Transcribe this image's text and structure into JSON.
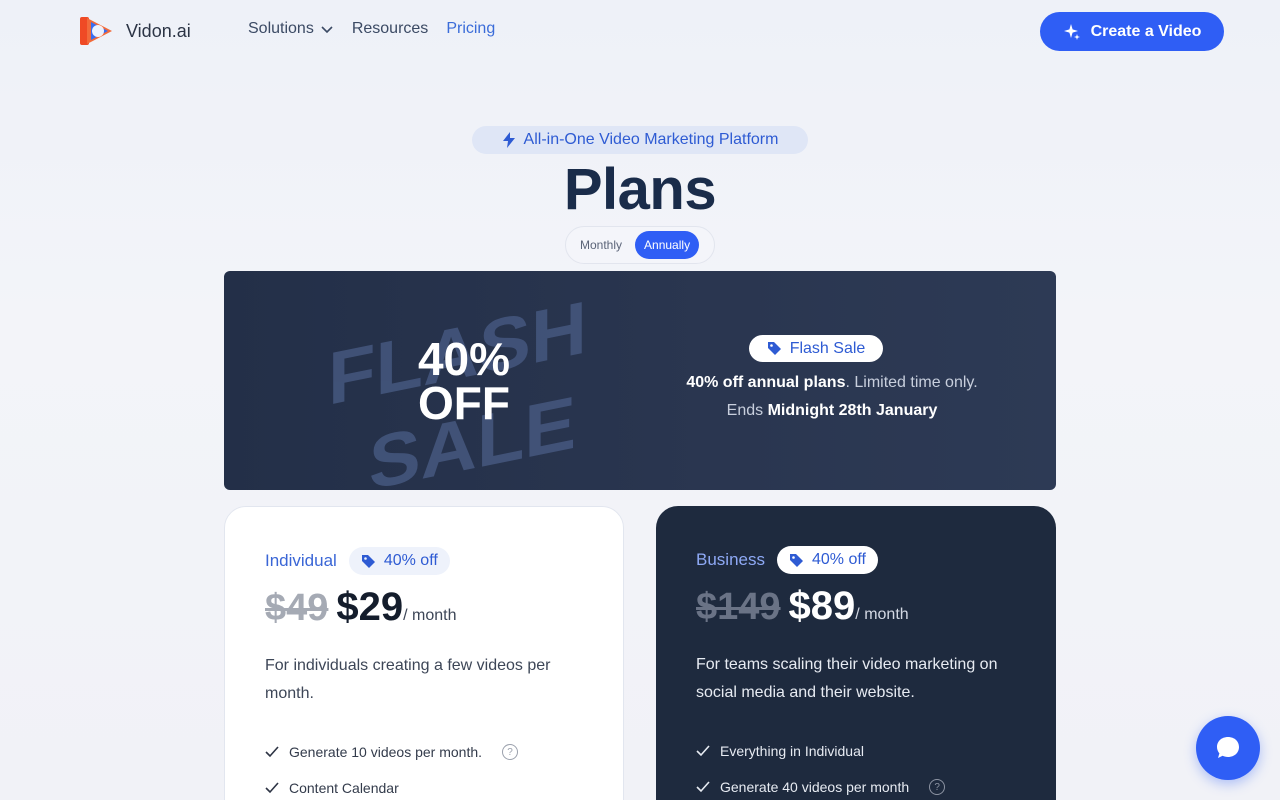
{
  "brand": {
    "name": "Vidon.ai"
  },
  "nav": {
    "items": [
      {
        "label": "Solutions",
        "has_dropdown": true
      },
      {
        "label": "Resources"
      },
      {
        "label": "Pricing",
        "active": true
      }
    ],
    "cta_label": "Create a Video"
  },
  "hero": {
    "badge": "All-in-One Video Marketing Platform",
    "title": "Plans",
    "toggle": {
      "options": [
        "Monthly",
        "Annually"
      ],
      "selected": "Annually"
    }
  },
  "banner": {
    "art_words": [
      "FLASH",
      "SALE"
    ],
    "discount_line1": "40%",
    "discount_line2": "OFF",
    "chip": "Flash Sale",
    "line1_bold": "40% off annual plans",
    "line1_rest": ". Limited time only.",
    "line2_prefix": "Ends ",
    "line2_bold": "Midnight 28th January"
  },
  "plans": [
    {
      "name": "Individual",
      "discount": "40% off",
      "old_price": "$49",
      "new_price": "$29",
      "period": "/ month",
      "description": "For individuals creating a few videos per month.",
      "features": [
        "Generate 10 videos per month.",
        "Content Calendar"
      ]
    },
    {
      "name": "Business",
      "discount": "40% off",
      "old_price": "$149",
      "new_price": "$89",
      "period": "/ month",
      "description": "For teams scaling their video marketing on social media and their website.",
      "features": [
        "Everything in Individual",
        "Generate 40 videos per month"
      ]
    }
  ],
  "colors": {
    "accent": "#2f5ef5",
    "dark_bg": "#1e2a3e",
    "title": "#1a2c4a"
  }
}
